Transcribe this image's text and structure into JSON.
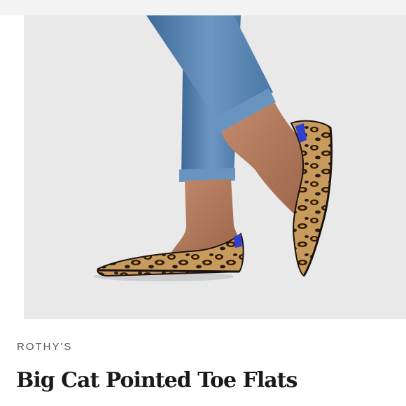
{
  "product": {
    "brand": "ROTHY'S",
    "title": "Big Cat Pointed Toe Flats"
  },
  "image": {
    "subject": "leopard-print-flats-product-photo",
    "background_color": "#e9e9ea"
  },
  "colors": {
    "denim": "#5b86b4",
    "denim_dark": "#3e6a98",
    "skin": "#b98063",
    "leopard_base": "#c89b5c",
    "leopard_spot": "#2a1d14",
    "leopard_orange": "#e0962f",
    "lining": "#2f3fd0",
    "text_primary": "#1a1a1a",
    "text_secondary": "#555555"
  }
}
